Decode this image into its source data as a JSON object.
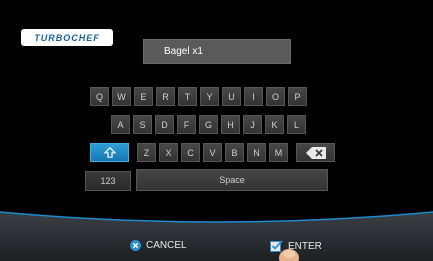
{
  "brand": {
    "logo_text": "TURBOCHEF"
  },
  "entry": {
    "value": "Bagel x1"
  },
  "keyboard": {
    "row1": [
      "Q",
      "W",
      "E",
      "R",
      "T",
      "Y",
      "U",
      "I",
      "O",
      "P"
    ],
    "row2": [
      "A",
      "S",
      "D",
      "F",
      "G",
      "H",
      "J",
      "K",
      "L"
    ],
    "row3": [
      "Z",
      "X",
      "C",
      "V",
      "B",
      "N",
      "M"
    ],
    "shift_icon": "shift-arrow-icon",
    "backspace_icon": "backspace-icon",
    "num_label": "123",
    "space_label": "Space"
  },
  "footer": {
    "cancel_label": "CANCEL",
    "enter_label": "ENTER",
    "cancel_icon": "close-circle-icon",
    "enter_icon": "checkbox-checked-icon"
  },
  "colors": {
    "accent": "#1a8ccf",
    "background": "#000000",
    "key": "#3c3c3c"
  }
}
